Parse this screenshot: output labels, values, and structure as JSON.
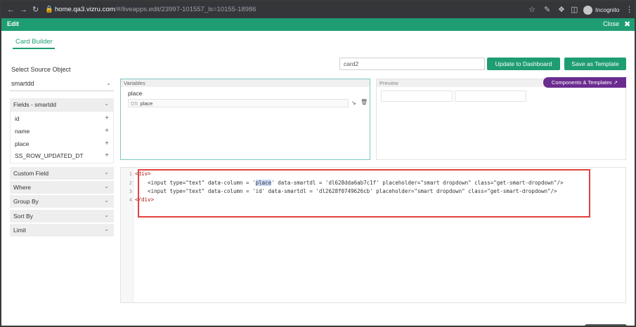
{
  "browser": {
    "url_host": "home.qa3.vizru.com",
    "url_path": "/#/liveapps.edit/23997-101557_ls=10155-18986",
    "profile_label": "Incognito"
  },
  "appbar": {
    "title": "Edit",
    "close_label": "Close"
  },
  "tabs": [
    {
      "label": "Card Builder",
      "active": true
    }
  ],
  "toolbar": {
    "card_name_value": "card2",
    "update_label": "Update to Dashboard",
    "save_template_label": "Save as Template"
  },
  "sidebar": {
    "source_label": "Select Source Object",
    "source_value": "smartdd",
    "fields_header": "Fields - smartdd",
    "fields": [
      "id",
      "name",
      "place",
      "SS_ROW_UPDATED_DT"
    ],
    "sections": [
      "Custom Field",
      "Where",
      "Group By",
      "Sort By",
      "Limit"
    ]
  },
  "variables": {
    "header": "Variables",
    "name": "place",
    "input_tag": "DS",
    "input_value": "place"
  },
  "preview": {
    "header": "Preview",
    "components_label": "Components & Templates"
  },
  "editor": {
    "lines": [
      {
        "num": "1",
        "text": "<div>"
      },
      {
        "num": "2",
        "pre": "    <input type=\"text\" data-column = '",
        "hl": "place",
        "post": "' data-smartdl = 'dl628dda6ab7c1f' placeholder=\"smart dropdown\" class=\"get-smart-dropdown\"/>"
      },
      {
        "num": "3",
        "text": "    <input type=\"text\" data-column = 'id' data-smartdl = 'dl2628f0749626cb' placeholder=\"smart dropdown\" class=\"get-smart-dropdown\"/>"
      },
      {
        "num": "4",
        "text": "</div>"
      }
    ]
  },
  "colors": {
    "brand_green": "#1f9d72",
    "components_purple": "#6b2c8f",
    "highlight_red": "#e0443e"
  }
}
